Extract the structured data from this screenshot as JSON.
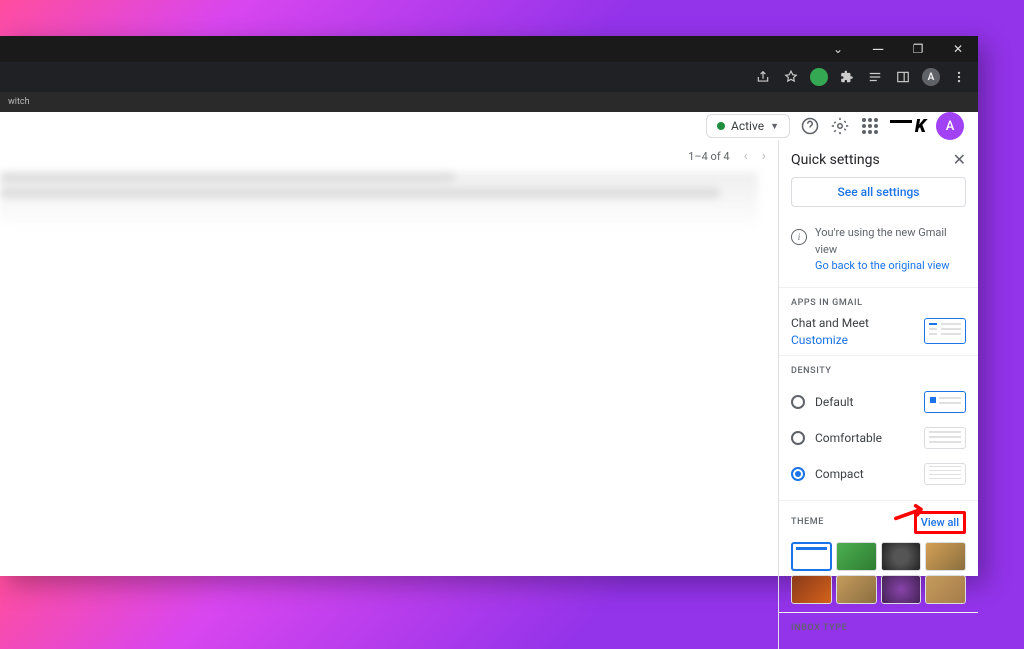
{
  "titlebar": {
    "min": "—",
    "max": "❐",
    "close": "✕",
    "dropdown": "⌄"
  },
  "toolbar": {
    "avatar_letter": "A"
  },
  "tab": {
    "label": "witch"
  },
  "header": {
    "active": "Active",
    "avatar_letter": "A"
  },
  "pager": {
    "range": "1–4 of 4"
  },
  "panel": {
    "title": "Quick settings",
    "see_all": "See all settings",
    "info_text": "You're using the new Gmail view",
    "info_link": "Go back to the original view",
    "apps_section": "APPS IN GMAIL",
    "apps_label": "Chat and Meet",
    "customize": "Customize",
    "density_section": "DENSITY",
    "density": {
      "default": "Default",
      "comfortable": "Comfortable",
      "compact": "Compact"
    },
    "theme_section": "THEME",
    "view_all": "View all",
    "inbox_section": "INBOX TYPE"
  }
}
